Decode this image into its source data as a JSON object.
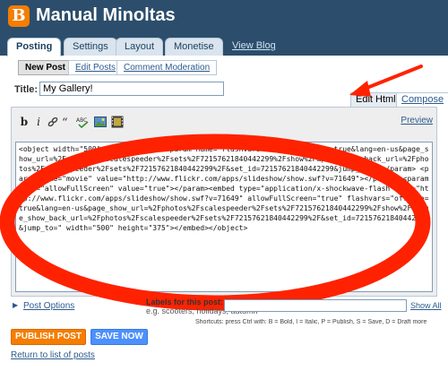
{
  "header": {
    "blog_title": "Manual Minoltas",
    "logo_icon": "blogger-logo-icon",
    "brand_color": "#f57d00",
    "bar_color": "#2c4e6c"
  },
  "nav": {
    "tabs": [
      {
        "label": "Posting",
        "active": true
      },
      {
        "label": "Settings",
        "active": false
      },
      {
        "label": "Layout",
        "active": false
      },
      {
        "label": "Monetise",
        "active": false
      }
    ],
    "view_blog": "View Blog"
  },
  "subnav": {
    "items": [
      {
        "label": "New Post",
        "active": true
      },
      {
        "label": "Edit Posts",
        "active": false
      },
      {
        "label": "Comment Moderation",
        "active": false
      }
    ]
  },
  "post": {
    "title_label": "Title:",
    "title_value": "My Gallery!"
  },
  "editor": {
    "mode_tabs": [
      {
        "label": "Edit Html",
        "active": true
      },
      {
        "label": "Compose",
        "active": false
      }
    ],
    "toolbar": {
      "bold_label": "b",
      "italic_label": "i",
      "link_icon": "link-icon",
      "quote_icon": "blockquote-icon",
      "spellcheck_icon": "spellcheck-icon",
      "image_icon": "image-icon",
      "video_icon": "video-icon"
    },
    "preview_label": "Preview",
    "html_content": "<object width=\"500\" height=\"375\"> <param name=\"flashvars\" value=\"offsite=true&lang=en-us&page_show_url=%2Fphotos%2Fscalespeeder%2Fsets%2F72157621840442299%2Fshow%2F&page_show_back_url=%2Fphotos%2Fscalespeeder%2Fsets%2F72157621840442299%2F&set_id=72157621840442299&jump_to=\"></param> <param name=\"movie\" value=\"http://www.flickr.com/apps/slideshow/show.swf?v=71649\"></param> <param name=\"allowFullScreen\" value=\"true\"></param><embed type=\"application/x-shockwave-flash\" src=\"http://www.flickr.com/apps/slideshow/show.swf?v=71649\" allowFullScreen=\"true\" flashvars=\"offsite=true&lang=en-us&page_show_url=%2Fphotos%2Fscalespeeder%2Fsets%2F72157621840442299%2Fshow%2F&page_show_back_url=%2Fphotos%2Fscalespeeder%2Fsets%2F72157621840442299%2F&set_id=72157621840442299&jump_to=\" width=\"500\" height=\"375\"></embed></object>"
  },
  "footer": {
    "post_options": "Post Options",
    "labels_title": "Labels for this post:",
    "labels_hint": "e.g. scooters, holidays, autumn",
    "show_all": "Show All",
    "shortcuts": "Shortcuts: press Ctrl with: B = Bold, I = Italic, P = Publish, S = Save, D = Draft more",
    "publish_label": "PUBLISH POST",
    "save_label": "SAVE NOW",
    "return_label": "Return to list of posts"
  },
  "annotation": {
    "color": "#ff2200"
  }
}
